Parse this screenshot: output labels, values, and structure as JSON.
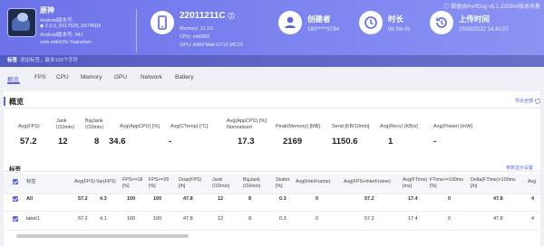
{
  "header": {
    "note": "◎ 数据由PerfDog v5.1.220304版本收集",
    "app": {
      "name": "原神",
      "lines": [
        "Android版本号:",
        "◆ 2.5.0_5517525_5674503",
        "Android版本号: 341",
        "com.miHoYo.Yuanshen"
      ]
    },
    "device": {
      "model": "22011211C",
      "info_icon": "ⓘ",
      "lines": [
        "Memory: 11.1G",
        "CPU: mt6983",
        "GPU: ARM Mali-G710 MC10"
      ]
    },
    "creator": {
      "title": "创建者",
      "value": "180*****9794"
    },
    "duration": {
      "title": "时长",
      "value": "0h 5m 0s"
    },
    "upload": {
      "title": "上传时间",
      "value": "15/03/2022 14:41:07"
    },
    "tags": {
      "label": "标签",
      "placeholder": "添加标签，最多100个字符"
    }
  },
  "tabs": [
    "概览",
    "FPS",
    "CPU",
    "Memory",
    "GPU",
    "Network",
    "Battery"
  ],
  "overview": {
    "title": "概览",
    "export": "导出全部",
    "metrics": [
      {
        "label": "Avg(FPS)",
        "value": "57.2"
      },
      {
        "label": "Jank\n(/10min)",
        "value": "12"
      },
      {
        "label": "BigJank\n(/10min)",
        "value": "8"
      },
      {
        "label": "Avg(AppCPU) [%]",
        "value": "34.6"
      },
      {
        "label": "Avg(CTemp) [°C]",
        "value": "-"
      },
      {
        "label": "Avg(AppCPU) [%]\nNormalized",
        "value": "17.3"
      },
      {
        "label": "Peak(Memory) [MB]",
        "value": "2169"
      },
      {
        "label": "Send [KB/10min]",
        "value": "1150.6"
      },
      {
        "label": "Avg(Recv) [KB/s]",
        "value": "1"
      },
      {
        "label": "Avg(Power) [mW]",
        "value": "-"
      }
    ]
  },
  "tagtable": {
    "title": "标签",
    "settings": "参数显示设置",
    "headers": [
      "标签",
      "Avg(FPS)",
      "Var(FPS)",
      "FPS>=18\n[%]",
      "FPS>=25\n[%]",
      "Drop(FPS)\n[/h]",
      "Jank\n(/10min)",
      "BigJank\n(/10min)",
      "Stutter\n[%]",
      "Avg(InterFrame)",
      "Avg(FPS+InterFrame)",
      "Avg(FTime)\n[ms]",
      "FTime>=100ms\n[%]",
      "Delta(FTime)>100ms\n[/h]",
      "Avg"
    ],
    "rows": [
      [
        "All",
        "57.2",
        "4.3",
        "100",
        "100",
        "47.8",
        "12",
        "8",
        "0.3",
        "0",
        "57.2",
        "17.4",
        "0",
        "47.8",
        "4"
      ],
      [
        "label1",
        "57.2",
        "4.1",
        "100",
        "100",
        "47.8",
        "12",
        "8",
        "0.3",
        "0",
        "57.2",
        "17.4",
        "0",
        "47.8",
        "4"
      ]
    ]
  },
  "colors": {
    "accent": "#5b63e6",
    "header_from": "#6c72e8",
    "header_to": "#8a93f3"
  }
}
